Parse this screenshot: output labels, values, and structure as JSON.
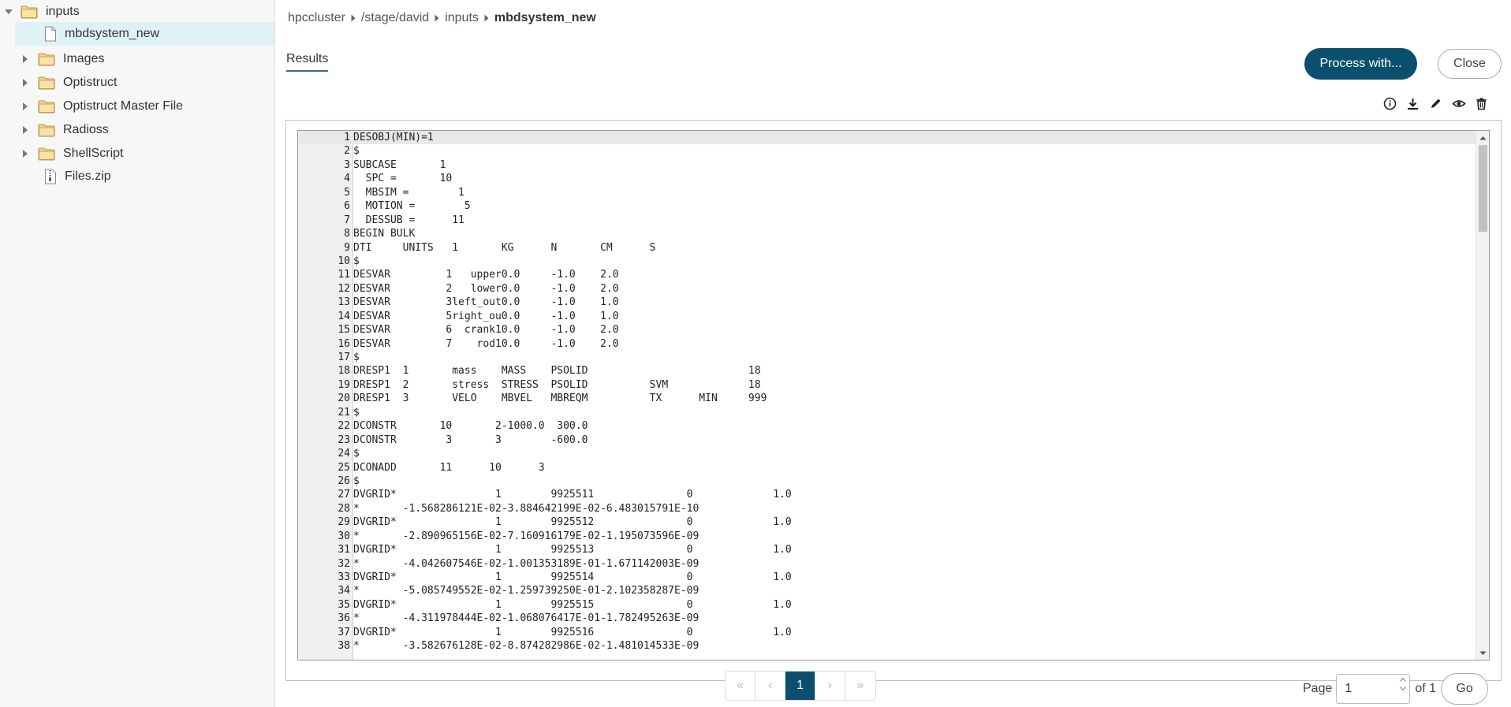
{
  "sidebar": {
    "items": [
      {
        "label": "inputs",
        "type": "folder",
        "expanded": true,
        "level": 0
      },
      {
        "label": "mbdsystem_new",
        "type": "file",
        "level": 1,
        "selected": true
      },
      {
        "label": "Images",
        "type": "folder",
        "expanded": false,
        "level": 1
      },
      {
        "label": "Optistruct",
        "type": "folder",
        "expanded": false,
        "level": 1
      },
      {
        "label": "Optistruct Master File",
        "type": "folder",
        "expanded": false,
        "level": 1
      },
      {
        "label": "Radioss",
        "type": "folder",
        "expanded": false,
        "level": 1
      },
      {
        "label": "ShellScript",
        "type": "folder",
        "expanded": false,
        "level": 1
      },
      {
        "label": "Files.zip",
        "type": "zip",
        "level": 1
      }
    ]
  },
  "breadcrumb": [
    "hpccluster",
    "/stage/david",
    "inputs",
    "mbdsystem_new"
  ],
  "tabs": [
    {
      "label": "Results",
      "active": true
    }
  ],
  "actions": {
    "process_label": "Process with...",
    "close_label": "Close"
  },
  "toolbar_icons": [
    "info-icon",
    "download-icon",
    "edit-icon",
    "view-icon",
    "delete-icon"
  ],
  "editor": {
    "lines": [
      "DESOBJ(MIN)=1",
      "$",
      "SUBCASE       1",
      "  SPC =       10",
      "  MBSIM =        1",
      "  MOTION =        5",
      "  DESSUB =      11",
      "BEGIN BULK",
      "DTI     UNITS   1       KG      N       CM      S",
      "$",
      "DESVAR         1   upper0.0     -1.0    2.0",
      "DESVAR         2   lower0.0     -1.0    2.0",
      "DESVAR         3left_out0.0     -1.0    1.0",
      "DESVAR         5right_ou0.0     -1.0    1.0",
      "DESVAR         6  crank10.0     -1.0    2.0",
      "DESVAR         7    rod10.0     -1.0    2.0",
      "$",
      "DRESP1  1       mass    MASS    PSOLID                          18",
      "DRESP1  2       stress  STRESS  PSOLID          SVM             18",
      "DRESP1  3       VELO    MBVEL   MBREQM          TX      MIN     999",
      "$",
      "DCONSTR       10       2-1000.0  300.0",
      "DCONSTR        3       3        -600.0",
      "$",
      "DCONADD       11      10      3",
      "$",
      "DVGRID*                1        9925511               0             1.0",
      "*       -1.568286121E-02-3.884642199E-02-6.483015791E-10",
      "DVGRID*                1        9925512               0             1.0",
      "*       -2.890965156E-02-7.160916179E-02-1.195073596E-09",
      "DVGRID*                1        9925513               0             1.0",
      "*       -4.042607546E-02-1.001353189E-01-1.671142003E-09",
      "DVGRID*                1        9925514               0             1.0",
      "*       -5.085749552E-02-1.259739250E-01-2.102358287E-09",
      "DVGRID*                1        9925515               0             1.0",
      "*       -4.311978444E-02-1.068076417E-01-1.782495263E-09",
      "DVGRID*                1        9925516               0             1.0",
      "*       -3.582676128E-02-8.874282986E-02-1.481014533E-09"
    ]
  },
  "pagination": {
    "first": "«",
    "prev": "‹",
    "current": "1",
    "next": "›",
    "last": "»",
    "page_label": "Page",
    "page_value": "1",
    "of_label": "of 1",
    "go_label": "Go"
  },
  "colors": {
    "accent": "#0a4f6e",
    "selected_bg": "#dff1f6"
  }
}
